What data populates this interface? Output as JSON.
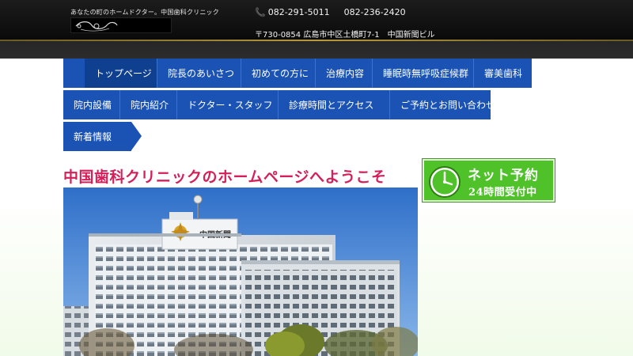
{
  "header": {
    "tagline": "あなたの町のホームドクター。中国歯科クリニック",
    "logo_name": "clinic-logo",
    "phone_icon": "📞",
    "phone_1": "082-291-5011",
    "phone_2": "082-236-2420",
    "address": "〒730-0854 広島市中区土橋町7-1　中国新聞ビル"
  },
  "nav": {
    "row1": [
      "トップページ",
      "院長のあいさつ",
      "初めての方に",
      "治療内容",
      "睡眠時無呼吸症候群",
      "審美歯科"
    ],
    "row2": [
      "院内設備",
      "院内紹介",
      "ドクター・スタッフ",
      "診療時間とアクセス",
      "ご予約とお問い合わせ"
    ],
    "news": "新着情報"
  },
  "main": {
    "welcome_title": "中国歯科クリニックのホームページへようこそ",
    "building_sign": "中国新聞"
  },
  "banner": {
    "line1": "ネット予約",
    "line2": "24時間受付中"
  },
  "colors": {
    "nav_blue": "#1b53b5",
    "title_pink": "#d4205a",
    "banner_green": "#4fc22a"
  }
}
